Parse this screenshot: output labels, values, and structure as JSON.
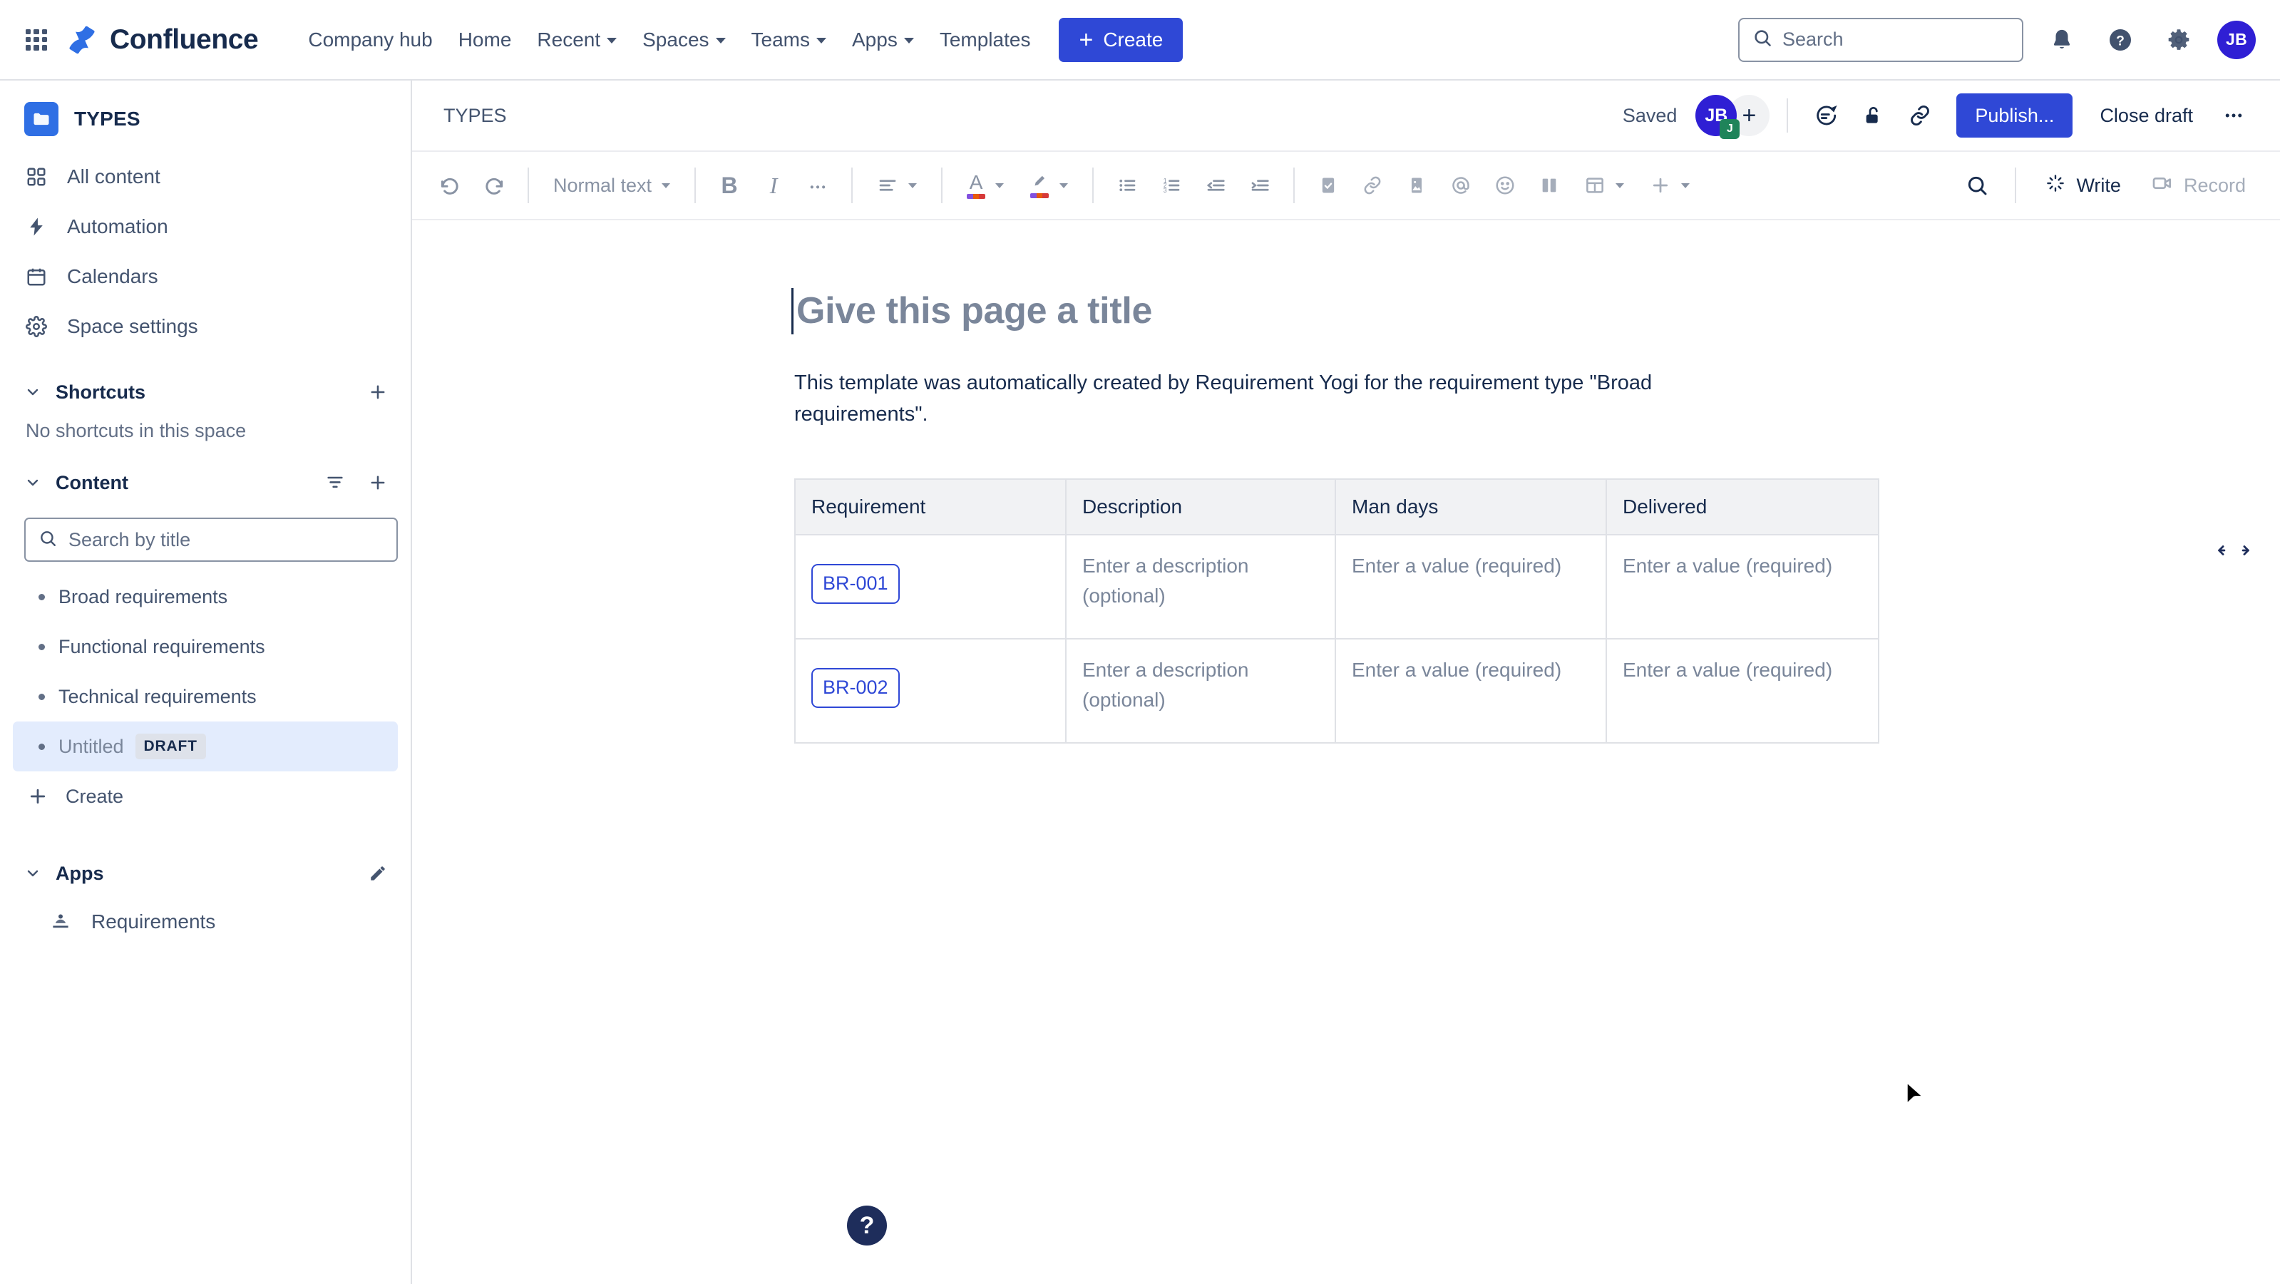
{
  "topnav": {
    "app_switcher_icon": "grid-apps-icon",
    "product_name": "Confluence",
    "logo_icon": "confluence-logo-icon",
    "links": [
      {
        "label": "Company hub",
        "has_caret": false
      },
      {
        "label": "Home",
        "has_caret": false
      },
      {
        "label": "Recent",
        "has_caret": true
      },
      {
        "label": "Spaces",
        "has_caret": true
      },
      {
        "label": "Teams",
        "has_caret": true
      },
      {
        "label": "Apps",
        "has_caret": true
      },
      {
        "label": "Templates",
        "has_caret": false
      }
    ],
    "create_label": "Create",
    "search_placeholder": "Search",
    "search_value": "",
    "notifications_icon": "bell-icon",
    "help_icon": "help-circle-icon",
    "settings_icon": "gear-icon",
    "avatar_initials": "JB",
    "accent_color": "#2f48d6",
    "avatar_color": "#2f1fd4"
  },
  "sidebar": {
    "space_name": "TYPES",
    "space_icon": "folder-icon",
    "nav": [
      {
        "label": "All content",
        "icon": "grid-squares-icon"
      },
      {
        "label": "Automation",
        "icon": "lightning-bolt-icon"
      },
      {
        "label": "Calendars",
        "icon": "calendar-icon"
      },
      {
        "label": "Space settings",
        "icon": "gear-icon"
      }
    ],
    "shortcuts": {
      "title": "Shortcuts",
      "add_icon": "plus-icon",
      "empty_text": "No shortcuts in this space"
    },
    "content": {
      "title": "Content",
      "filter_icon": "filter-icon",
      "add_icon": "plus-icon",
      "search_placeholder": "Search by title",
      "search_value": "",
      "pages": [
        {
          "label": "Broad requirements",
          "badge": "",
          "active": false
        },
        {
          "label": "Functional requirements",
          "badge": "",
          "active": false
        },
        {
          "label": "Technical requirements",
          "badge": "",
          "active": false
        },
        {
          "label": "Untitled",
          "badge": "DRAFT",
          "active": true
        }
      ],
      "create_label": "Create",
      "create_icon": "plus-icon"
    },
    "apps": {
      "title": "Apps",
      "edit_icon": "pencil-icon",
      "items": [
        {
          "label": "Requirements",
          "icon": "requirement-yogi-icon"
        }
      ]
    },
    "active_highlight_color": "#e3ecfd"
  },
  "page_header": {
    "breadcrumb": "TYPES",
    "status_label": "Saved",
    "avatar_initials": "JB",
    "avatar_badge": "J",
    "add_people_icon": "plus-icon",
    "comment_icon": "comment-icon",
    "restrictions_icon": "unlock-icon",
    "copy_link_icon": "link-icon",
    "publish_label": "Publish...",
    "close_draft_label": "Close draft",
    "more_icon": "more-ellipsis-icon"
  },
  "toolbar": {
    "undo_icon": "undo-icon",
    "redo_icon": "redo-icon",
    "text_style_label": "Normal text",
    "bold_label": "B",
    "italic_label": "I",
    "more_formatting_icon": "ellipsis-icon",
    "align_icon": "text-align-icon",
    "text_color_label": "A",
    "highlight_icon": "highlighter-icon",
    "bullet_list_icon": "bullet-list-icon",
    "numbered_list_icon": "numbered-list-icon",
    "outdent_icon": "outdent-icon",
    "indent_icon": "indent-icon",
    "action_item_icon": "checkbox-icon",
    "link_icon": "link-icon",
    "image_icon": "image-icon",
    "mention_icon": "at-mention-icon",
    "emoji_icon": "emoji-icon",
    "layout_icon": "columns-layout-icon",
    "table_icon": "table-icon",
    "insert_icon": "plus-icon",
    "find_icon": "search-icon",
    "write_label": "Write",
    "write_icon": "ai-sparkle-icon",
    "record_label": "Record",
    "record_icon": "video-camera-icon"
  },
  "document": {
    "title_placeholder": "Give this page a title",
    "resize_icon": "horizontal-resize-arrows-icon",
    "paragraph": "This template was automatically created by Requirement Yogi for the requirement type \"Broad requirements\".",
    "table": {
      "headers": [
        "Requirement",
        "Description",
        "Man days",
        "Delivered"
      ],
      "rows": [
        {
          "requirement": "BR-001",
          "description": "Enter a description (optional)",
          "man_days": "Enter a value (required)",
          "delivered": "Enter a value (required)"
        },
        {
          "requirement": "BR-002",
          "description": "Enter a description (optional)",
          "man_days": "Enter a value (required)",
          "delivered": "Enter a value (required)"
        }
      ]
    },
    "help_fab_label": "?",
    "help_fab_icon": "help-circle-icon"
  }
}
